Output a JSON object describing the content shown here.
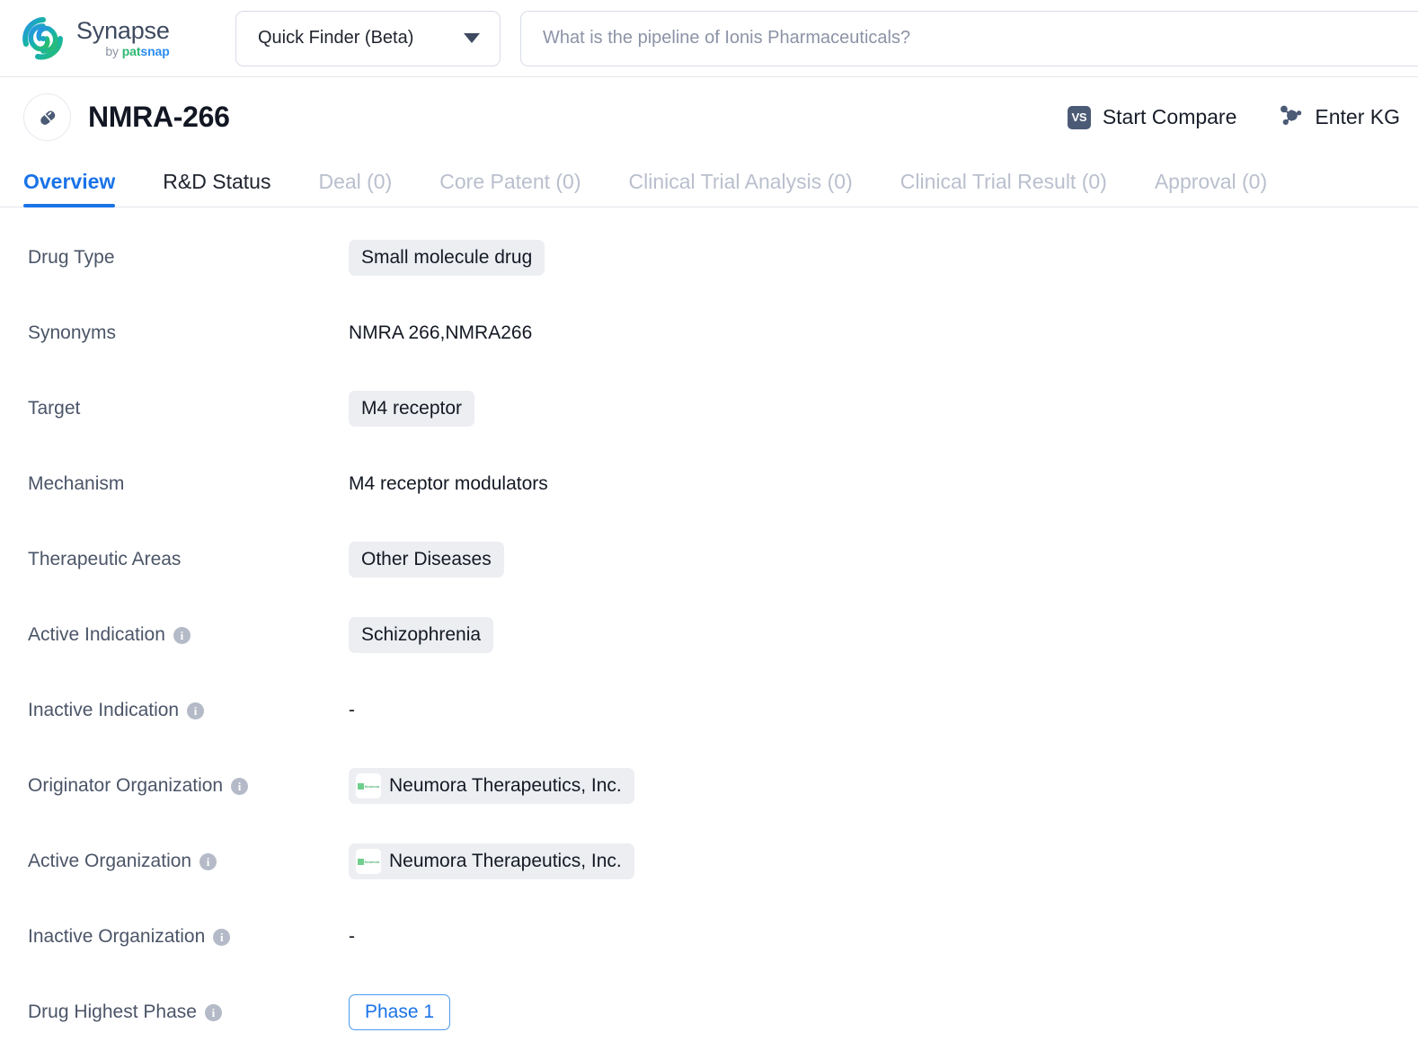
{
  "header": {
    "brand": {
      "name": "Synapse",
      "sub_by": "by ",
      "sub_pat": "pat",
      "sub_snap": "snap",
      "logo_icon": "synapse-swirl-logo"
    },
    "finder": {
      "label": "Quick Finder (Beta)",
      "caret_icon": "chevron-down-icon"
    },
    "search": {
      "value": "",
      "placeholder": "What is the pipeline of Ionis Pharmaceuticals?",
      "icon": "search-input"
    }
  },
  "title_bar": {
    "drug_icon": "pill-capsule-icon",
    "title": "NMRA-266",
    "actions": [
      {
        "label": "Start Compare",
        "icon": "vs-badge-icon",
        "badge_text": "VS"
      },
      {
        "label": "Enter KG",
        "icon": "knowledge-graph-icon"
      }
    ]
  },
  "tabs": [
    {
      "label": "Overview",
      "state": "active"
    },
    {
      "label": "R&D Status",
      "state": "enabled"
    },
    {
      "label": "Deal (0)",
      "state": "disabled"
    },
    {
      "label": "Core Patent (0)",
      "state": "disabled"
    },
    {
      "label": "Clinical Trial Analysis (0)",
      "state": "disabled"
    },
    {
      "label": "Clinical Trial Result (0)",
      "state": "disabled"
    },
    {
      "label": "Approval (0)",
      "state": "disabled"
    }
  ],
  "details": [
    {
      "label": "Drug Type",
      "has_info": false,
      "value_type": "chip",
      "value": "Small molecule drug"
    },
    {
      "label": "Synonyms",
      "has_info": false,
      "value_type": "text",
      "value": "NMRA 266,NMRA266"
    },
    {
      "label": "Target",
      "has_info": false,
      "value_type": "chip",
      "value": "M4 receptor"
    },
    {
      "label": "Mechanism",
      "has_info": false,
      "value_type": "text",
      "value": "M4 receptor modulators"
    },
    {
      "label": "Therapeutic Areas",
      "has_info": false,
      "value_type": "chip",
      "value": "Other Diseases"
    },
    {
      "label": "Active Indication",
      "has_info": true,
      "value_type": "chip",
      "value": "Schizophrenia"
    },
    {
      "label": "Inactive Indication",
      "has_info": true,
      "value_type": "dash",
      "value": "-"
    },
    {
      "label": "Originator Organization",
      "has_info": true,
      "value_type": "org",
      "value": "Neumora Therapeutics, Inc.",
      "logo_text": "Neumora"
    },
    {
      "label": "Active Organization",
      "has_info": true,
      "value_type": "org",
      "value": "Neumora Therapeutics, Inc.",
      "logo_text": "Neumora"
    },
    {
      "label": "Inactive Organization",
      "has_info": true,
      "value_type": "dash",
      "value": "-"
    },
    {
      "label": "Drug Highest Phase",
      "has_info": true,
      "value_type": "button",
      "value": "Phase 1"
    }
  ],
  "info_icon_glyph": "i",
  "colors": {
    "accent_blue": "#1a73e8",
    "chip_bg": "#eceef2",
    "label_text": "#4b5568",
    "disabled_tab": "#b9bfcd",
    "brand_green": "#2eb872",
    "brand_blue": "#2a8df0",
    "slate": "#4b5a75"
  }
}
